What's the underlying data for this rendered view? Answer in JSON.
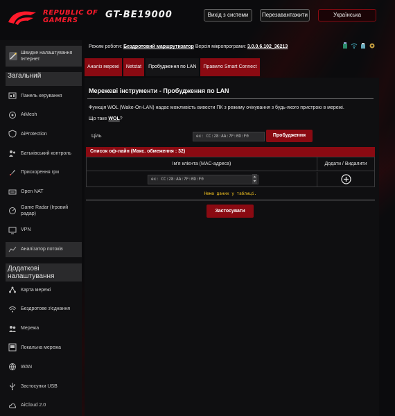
{
  "header": {
    "brand_line1": "REPUBLIC OF",
    "brand_line2": "GAMERS",
    "model": "GT-BE19000",
    "logout_label": "Вихід з системи",
    "reboot_label": "Перезавантажити",
    "language": "Українська"
  },
  "sidebar": {
    "quick_setup": "Швидке налаштування Інтернет",
    "general_title": "Загальний",
    "general_items": [
      {
        "label": "Панель керування",
        "icon": "dashboard-icon"
      },
      {
        "label": "AiMesh",
        "icon": "mesh-icon"
      },
      {
        "label": "AiProtection",
        "icon": "shield-icon"
      },
      {
        "label": "Батьківський контроль",
        "icon": "parental-icon"
      },
      {
        "label": "Прискорення гри",
        "icon": "rocket-icon"
      },
      {
        "label": "Open NAT",
        "icon": "nat-icon"
      },
      {
        "label": "Game Radar (Ігровий радар)",
        "icon": "radar-icon"
      },
      {
        "label": "VPN",
        "icon": "vpn-icon"
      },
      {
        "label": "Аналізатор потоків",
        "icon": "traffic-icon"
      }
    ],
    "advanced_title": "Додаткові налаштування",
    "advanced_items": [
      {
        "label": "Карта мережі",
        "icon": "network-map-icon"
      },
      {
        "label": "Бездротове з'єднання",
        "icon": "wireless-icon"
      },
      {
        "label": "Мережа",
        "icon": "guest-network-icon"
      },
      {
        "label": "Локальна мережа",
        "icon": "lan-icon"
      },
      {
        "label": "WAN",
        "icon": "globe-icon"
      },
      {
        "label": "Застосунки USB",
        "icon": "usb-icon"
      },
      {
        "label": "AiCloud 2.0",
        "icon": "cloud-icon"
      }
    ]
  },
  "status": {
    "mode_prefix": "Режим роботи:",
    "mode_value": "Бездротовий маршрутизатор",
    "fw_prefix": "Версія мікропрограми:",
    "fw_value": "3.0.0.6.102_36213"
  },
  "tabs": [
    {
      "label": "Аналіз мережі",
      "active": false
    },
    {
      "label": "Netstat",
      "active": false
    },
    {
      "label": "Пробудження по LAN",
      "active": true
    },
    {
      "label": "Правило Smart Connect",
      "active": false
    }
  ],
  "main": {
    "title": "Мережеві інструменти - Пробудження по LAN",
    "description": "Функція WOL (Wake-On-LAN) надає можливість вивести ПК з режиму очікування з будь-якого пристрою в мережі.",
    "what_prefix": "Що таке",
    "what_link": "WOL",
    "what_suffix": "?",
    "target_label": "Ціль",
    "mac_placeholder": "ex: CC:28:AA:7F:0D:F0",
    "wake_button": "Пробудження",
    "list_title": "Список оф-лайн (Макс. обмеження : 32)",
    "col_client": "Ім'я клієнта (MAC-адреса)",
    "col_action": "Додати / Видалити",
    "no_data": "Нема даних у таблиці.",
    "apply_button": "Застосувати"
  },
  "colors": {
    "accent": "#8a0a12",
    "brand": "#ff1a2b",
    "warning_text": "#f0c020"
  }
}
